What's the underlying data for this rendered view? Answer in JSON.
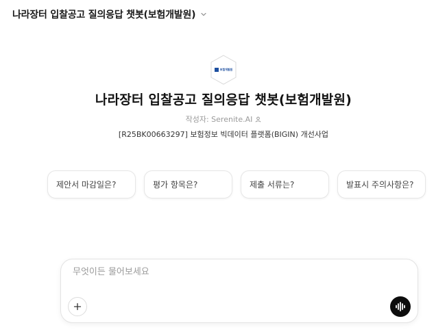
{
  "header": {
    "title": "나라장터 입찰공고 질의응답 챗봇(보험개발원)",
    "dropdown_icon": "chevron-down-icon"
  },
  "hero": {
    "logo_text": "보험개발원",
    "title": "나라장터 입찰공고 질의응답 챗봇(보험개발원)",
    "author": "작성자: Serenite.AI",
    "description": "[R25BK00663297] 보험정보 빅데이터 플랫폼(BIGIN) 개선사업"
  },
  "suggestions": [
    {
      "label": "제안서 마감일은?"
    },
    {
      "label": "평가 항목은?"
    },
    {
      "label": "제출 서류는?"
    },
    {
      "label": "발표시 주의사항은?"
    }
  ],
  "composer": {
    "placeholder": "무엇이든 물어보세요",
    "value": "",
    "add_icon": "plus-icon",
    "voice_icon": "voice-waveform-icon"
  },
  "colors": {
    "background": "#ffffff",
    "voice_button": "#0d0d0d",
    "logo_blue": "#1d4fa0"
  }
}
